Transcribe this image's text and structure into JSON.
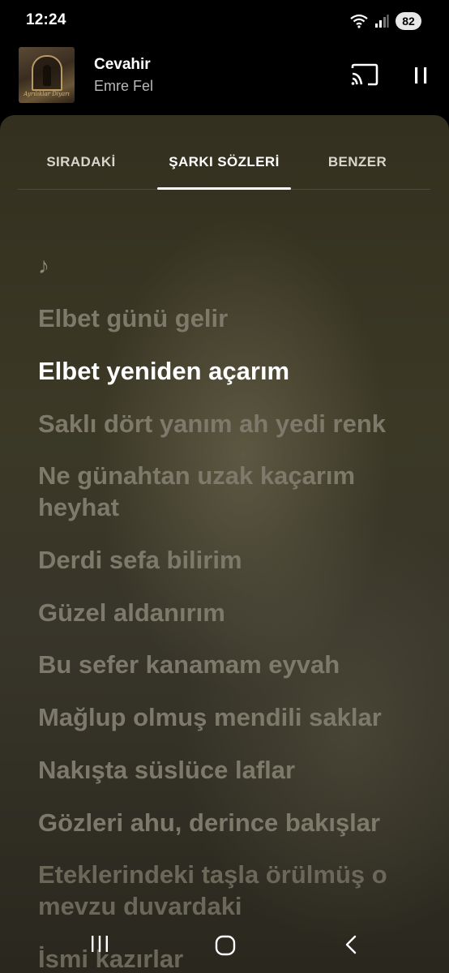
{
  "status_bar": {
    "time": "12:24",
    "battery": "82",
    "icons": [
      "wifi-icon",
      "signal-icon",
      "battery-icon"
    ]
  },
  "mini_player": {
    "title": "Cevahir",
    "artist": "Emre Fel",
    "album_art_caption": "Ayrılıklar Diyarı",
    "icons": [
      "cast-icon",
      "pause-icon"
    ]
  },
  "tabs": [
    {
      "label": "SIRADAKİ",
      "selected": false
    },
    {
      "label": "ŞARKI SÖZLERİ",
      "selected": true
    },
    {
      "label": "BENZER",
      "selected": false
    }
  ],
  "lyrics": {
    "note": "♪",
    "lines": [
      "Elbet günü gelir",
      "Elbet yeniden açarım",
      "Saklı dört yanım ah yedi renk",
      "Ne günahtan uzak kaçarım heyhat",
      "Derdi sefa bilirim",
      "Güzel aldanırım",
      "Bu sefer kanamam eyvah",
      "Mağlup olmuş mendili saklar",
      "Nakışta süslüce laflar",
      "Gözleri ahu, derince bakışlar",
      "Eteklerindeki taşla örülmüş o mevzu duvardaki",
      "İsmi kazırlar"
    ],
    "active_index": 1
  },
  "nav_bar": {
    "icons": [
      "recent-apps-icon",
      "home-icon",
      "back-icon"
    ]
  },
  "colors": {
    "background": "#000000",
    "sheet": "#3a3726",
    "active_lyric": "#ffffff",
    "inactive_lyric": "#7d7a6b"
  }
}
